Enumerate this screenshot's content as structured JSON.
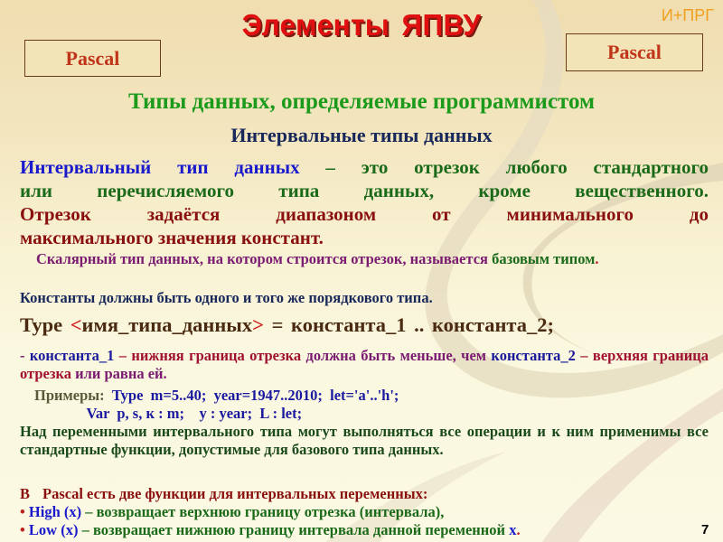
{
  "header": {
    "title_part1": "Элементы",
    "title_part2": "ЯПВУ",
    "corner_tag": "И+ПРГ",
    "left_box": "Pascal",
    "right_box": "Pascal"
  },
  "subtitle": "Типы данных, определяемые программистом",
  "section_title": "Интервальные типы данных",
  "definition": {
    "term": "Интервальный тип данных",
    "line1_rest": " – это отрезок любого стандартного",
    "line2": "или перечисляемого типа данных, кроме вещественного.",
    "line3": "Отрезок задаётся диапазоном  от минимального до",
    "line4": "максимального значения констант."
  },
  "base_type": {
    "text": "Скалярный тип данных, на котором строится отрезок, называется",
    "term": "базовым типом",
    "end": "."
  },
  "constants_note": "Константы должны быть одного и того же порядкового типа.",
  "syntax": {
    "keyword": "Type",
    "open": "<",
    "name": "имя_типа_данных",
    "close": ">",
    "rest": "= константа_1 .. константа_2;"
  },
  "bounds": {
    "lead": "- ",
    "c1": "константа_1",
    "c1_text_red": " – нижняя граница отрезка ",
    "c1_text_purple": "должна быть меньше, чем",
    "c2": "константа_2",
    "c2_text_red": " – верхняя граница отрезка ",
    "c2_text_purple": "или равна ей."
  },
  "examples": {
    "label": "Примеры:",
    "line1": "  Type  m=5..40;  year=1947..2010;  let='a'..'h';",
    "line2": "              Var  p, s, к : m;    y : year;  L : let;"
  },
  "operations_note": "Над переменными интервального типа могут выполняться все операции и к ним применимы все стандартные функции, допустимые для базового типа данных.",
  "functions": {
    "intro_b": "В",
    "intro_rest": "Pascal есть две функции для интервальных переменных:",
    "items": [
      {
        "bullet": "•",
        "name": "High (x)",
        "desc": " – возвращает верхнюю границу отрезка (интервала),",
        "tail": ""
      },
      {
        "bullet": "•",
        "name": "Low (x)",
        "desc": " – возвращает нижнюю границу интервала данной переменной ",
        "tail": "x"
      }
    ],
    "end_dot": "."
  },
  "slide_number": "7"
}
